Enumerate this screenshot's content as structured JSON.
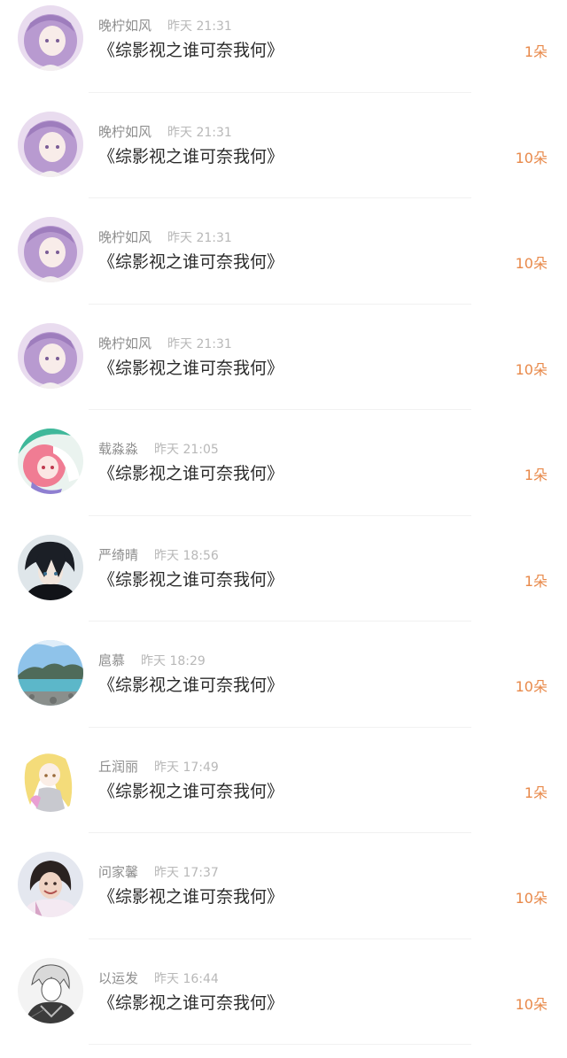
{
  "gifts": [
    {
      "user": "晚柠如风",
      "time": "昨天 21:31",
      "book": "《综影视之谁可奈我何》",
      "amount": "1朵",
      "avatar": "purple-hair-girl"
    },
    {
      "user": "晚柠如风",
      "time": "昨天 21:31",
      "book": "《综影视之谁可奈我何》",
      "amount": "10朵",
      "avatar": "purple-hair-girl"
    },
    {
      "user": "晚柠如风",
      "time": "昨天 21:31",
      "book": "《综影视之谁可奈我何》",
      "amount": "10朵",
      "avatar": "purple-hair-girl"
    },
    {
      "user": "晚柠如风",
      "time": "昨天 21:31",
      "book": "《综影视之谁可奈我何》",
      "amount": "10朵",
      "avatar": "purple-hair-girl"
    },
    {
      "user": "载淼淼",
      "time": "昨天 21:05",
      "book": "《综影视之谁可奈我何》",
      "amount": "1朵",
      "avatar": "pink-hair-girl"
    },
    {
      "user": "严绮晴",
      "time": "昨天 18:56",
      "book": "《综影视之谁可奈我何》",
      "amount": "1朵",
      "avatar": "dark-hair-boy"
    },
    {
      "user": "扈慕",
      "time": "昨天 18:29",
      "book": "《综影视之谁可奈我何》",
      "amount": "10朵",
      "avatar": "lake-landscape"
    },
    {
      "user": "丘润丽",
      "time": "昨天 17:49",
      "book": "《综影视之谁可奈我何》",
      "amount": "1朵",
      "avatar": "blonde-anime-girl"
    },
    {
      "user": "问家馨",
      "time": "昨天 17:37",
      "book": "《综影视之谁可奈我何》",
      "amount": "10朵",
      "avatar": "woman-in-snow"
    },
    {
      "user": "以运发",
      "time": "昨天 16:44",
      "book": "《综影视之谁可奈我何》",
      "amount": "10朵",
      "avatar": "sketch-character"
    }
  ]
}
